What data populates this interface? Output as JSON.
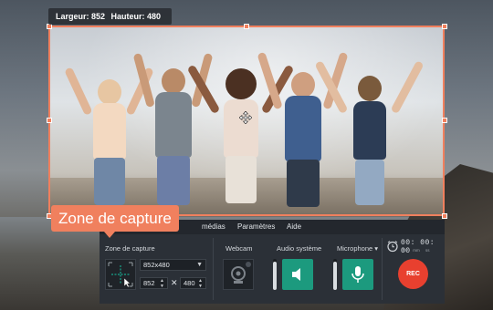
{
  "capture_size": {
    "width_label": "Largeur: 852",
    "height_label": "Hauteur: 480"
  },
  "tooltip": {
    "text": "Zone de capture"
  },
  "menu": {
    "items": [
      "médias",
      "Paramètres",
      "Aide"
    ]
  },
  "panel": {
    "capture_label": "Zone de capture",
    "resolution_value": "852x480",
    "width_value": "852",
    "height_value": "480",
    "times_sign": "✕",
    "webcam_label": "Webcam",
    "audio_label": "Audio système",
    "microphone_label": "Microphone",
    "microphone_caret": "▾"
  },
  "timer": {
    "digits": "00: 00: 00",
    "units": "hh mm ss"
  },
  "rec_label": "REC",
  "levels": {
    "system_audio": 0.9,
    "microphone": 0.9
  },
  "colors": {
    "accent": "#f0805e",
    "green": "#1c9a7e",
    "rec": "#e8402f",
    "panel": "#2b3037"
  }
}
